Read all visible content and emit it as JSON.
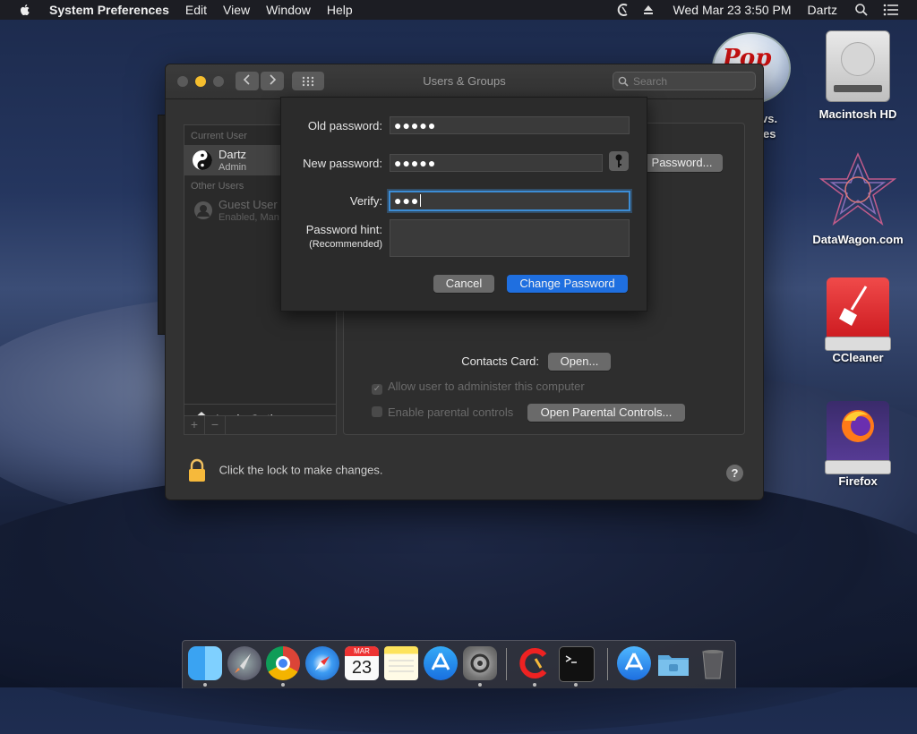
{
  "menubar": {
    "app": "System Preferences",
    "items": [
      "Edit",
      "View",
      "Window",
      "Help"
    ],
    "datetime": "Wed Mar 23  3:50 PM",
    "user": "Dartz"
  },
  "desktop": {
    "icons": [
      {
        "label": "Macintosh HD"
      },
      {
        "label": "DataWagon.com"
      },
      {
        "label": "CCleaner"
      },
      {
        "label": "Firefox"
      }
    ],
    "partial_labels": [
      "vs.",
      "es"
    ]
  },
  "window": {
    "title": "Users & Groups",
    "search_placeholder": "Search",
    "sidebar": {
      "current_user_header": "Current User",
      "current_user": {
        "name": "Dartz",
        "role": "Admin"
      },
      "other_users_header": "Other Users",
      "guest": {
        "name": "Guest User",
        "role": "Enabled, Man"
      },
      "login_options": "Login Options",
      "add": "+",
      "remove": "−"
    },
    "panel": {
      "password_button": "Password...",
      "contacts_label": "Contacts Card:",
      "open_button": "Open...",
      "allow_admin": "Allow user to administer this computer",
      "parental": "Enable parental controls",
      "parental_button": "Open Parental Controls..."
    },
    "lock_text": "Click the lock to make changes.",
    "help": "?"
  },
  "sheet": {
    "old_label": "Old password:",
    "old_value": "●●●●●",
    "new_label": "New password:",
    "new_value": "●●●●●",
    "verify_label": "Verify:",
    "verify_value": "●●●",
    "hint_label": "Password hint:",
    "hint_sub": "(Recommended)",
    "cancel": "Cancel",
    "change": "Change Password"
  },
  "dock": {
    "calendar_month": "MAR",
    "calendar_day": "23"
  }
}
